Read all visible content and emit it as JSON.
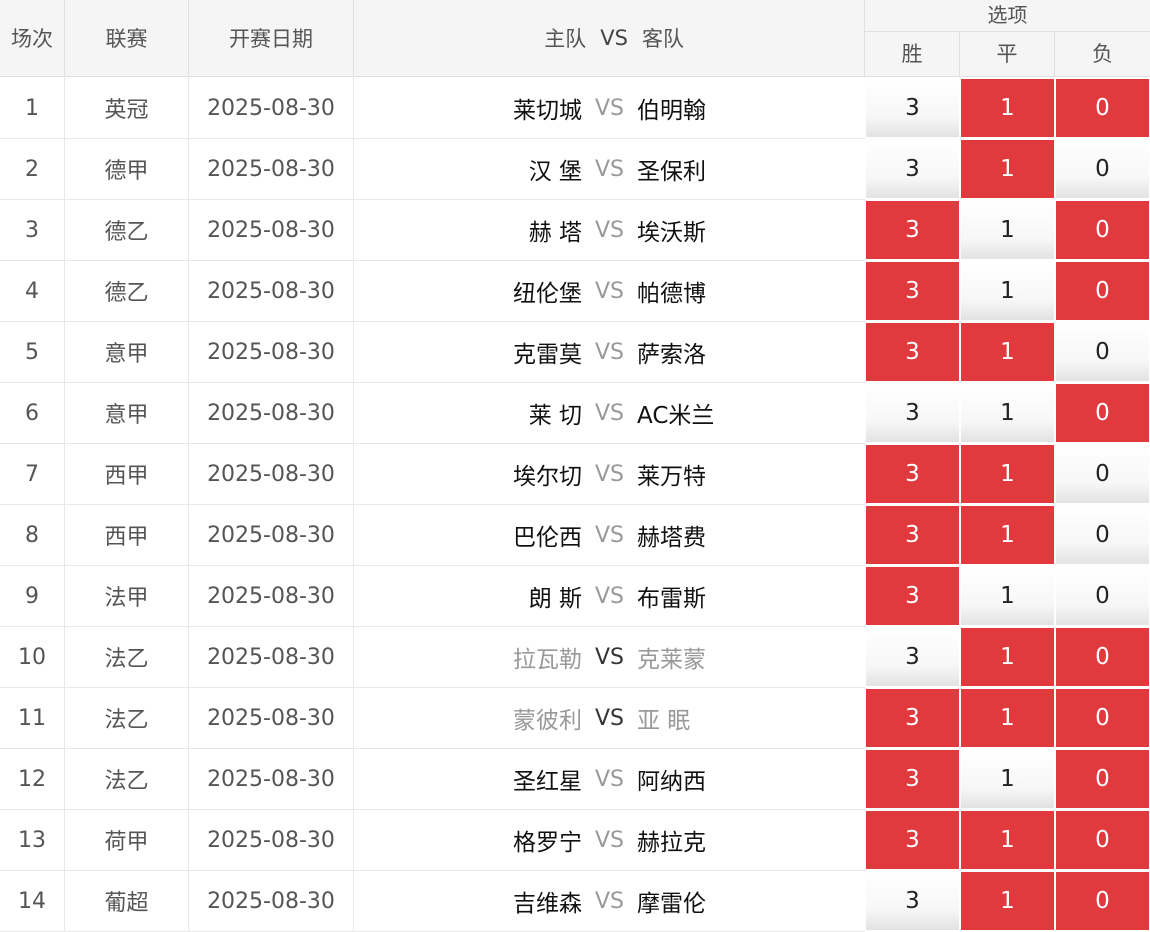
{
  "header": {
    "no": "场次",
    "league": "联赛",
    "date": "开赛日期",
    "home": "主队",
    "vs": "VS",
    "away": "客队",
    "options_title": "选项",
    "win": "胜",
    "draw": "平",
    "lose": "负"
  },
  "rows": [
    {
      "no": "1",
      "league": "英冠",
      "date": "2025-08-30",
      "home": "莱切城",
      "vs": "VS",
      "away": "伯明翰",
      "win": "3",
      "draw": "1",
      "lose": "0",
      "sel": [
        false,
        true,
        true
      ]
    },
    {
      "no": "2",
      "league": "德甲",
      "date": "2025-08-30",
      "home": "汉 堡",
      "vs": "VS",
      "away": "圣保利",
      "win": "3",
      "draw": "1",
      "lose": "0",
      "sel": [
        false,
        true,
        false
      ]
    },
    {
      "no": "3",
      "league": "德乙",
      "date": "2025-08-30",
      "home": "赫 塔",
      "vs": "VS",
      "away": "埃沃斯",
      "win": "3",
      "draw": "1",
      "lose": "0",
      "sel": [
        true,
        false,
        true
      ]
    },
    {
      "no": "4",
      "league": "德乙",
      "date": "2025-08-30",
      "home": "纽伦堡",
      "vs": "VS",
      "away": "帕德博",
      "win": "3",
      "draw": "1",
      "lose": "0",
      "sel": [
        true,
        false,
        true
      ]
    },
    {
      "no": "5",
      "league": "意甲",
      "date": "2025-08-30",
      "home": "克雷莫",
      "vs": "VS",
      "away": "萨索洛",
      "win": "3",
      "draw": "1",
      "lose": "0",
      "sel": [
        true,
        true,
        false
      ]
    },
    {
      "no": "6",
      "league": "意甲",
      "date": "2025-08-30",
      "home": "莱 切",
      "vs": "VS",
      "away": "AC米兰",
      "win": "3",
      "draw": "1",
      "lose": "0",
      "sel": [
        false,
        false,
        true
      ]
    },
    {
      "no": "7",
      "league": "西甲",
      "date": "2025-08-30",
      "home": "埃尔切",
      "vs": "VS",
      "away": "莱万特",
      "win": "3",
      "draw": "1",
      "lose": "0",
      "sel": [
        true,
        true,
        false
      ]
    },
    {
      "no": "8",
      "league": "西甲",
      "date": "2025-08-30",
      "home": "巴伦西",
      "vs": "VS",
      "away": "赫塔费",
      "win": "3",
      "draw": "1",
      "lose": "0",
      "sel": [
        true,
        true,
        false
      ]
    },
    {
      "no": "9",
      "league": "法甲",
      "date": "2025-08-30",
      "home": "朗 斯",
      "vs": "VS",
      "away": "布雷斯",
      "win": "3",
      "draw": "1",
      "lose": "0",
      "sel": [
        true,
        false,
        false
      ]
    },
    {
      "no": "10",
      "league": "法乙",
      "date": "2025-08-30",
      "home": "拉瓦勒",
      "vs": "VS",
      "away": "克莱蒙",
      "win": "3",
      "draw": "1",
      "lose": "0",
      "sel": [
        false,
        true,
        true
      ],
      "faded": true
    },
    {
      "no": "11",
      "league": "法乙",
      "date": "2025-08-30",
      "home": "蒙彼利",
      "vs": "VS",
      "away": "亚 眠",
      "win": "3",
      "draw": "1",
      "lose": "0",
      "sel": [
        true,
        true,
        true
      ],
      "faded": true
    },
    {
      "no": "12",
      "league": "法乙",
      "date": "2025-08-30",
      "home": "圣红星",
      "vs": "VS",
      "away": "阿纳西",
      "win": "3",
      "draw": "1",
      "lose": "0",
      "sel": [
        true,
        false,
        true
      ]
    },
    {
      "no": "13",
      "league": "荷甲",
      "date": "2025-08-30",
      "home": "格罗宁",
      "vs": "VS",
      "away": "赫拉克",
      "win": "3",
      "draw": "1",
      "lose": "0",
      "sel": [
        true,
        true,
        true
      ]
    },
    {
      "no": "14",
      "league": "葡超",
      "date": "2025-08-30",
      "home": "吉维森",
      "vs": "VS",
      "away": "摩雷伦",
      "win": "3",
      "draw": "1",
      "lose": "0",
      "sel": [
        false,
        true,
        true
      ]
    }
  ],
  "colors": {
    "selected": "#e0393e",
    "unselected": "#f5f5f5"
  }
}
